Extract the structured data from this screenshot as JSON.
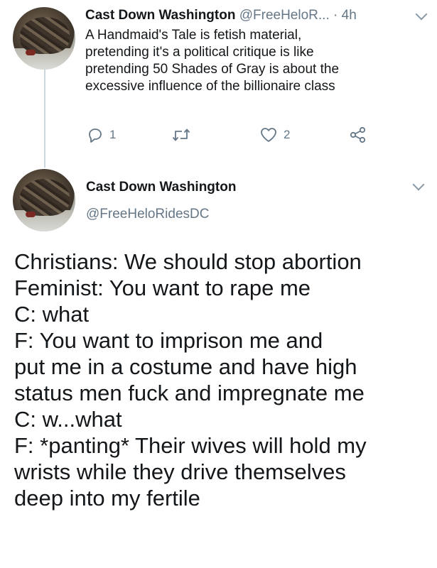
{
  "tweet1": {
    "author_name": "Cast Down Washington",
    "author_handle": "@FreeHeloR...",
    "separator": "·",
    "time": "4h",
    "text_lines": [
      "A Handmaid's Tale is fetish material,",
      "pretending it's a political critique is like",
      "pretending 50 Shades of Gray is about the",
      "excessive influence of the billionaire class"
    ],
    "reply_count": "1",
    "retweet_count": "",
    "like_count": "2"
  },
  "tweet2": {
    "author_name": "Cast Down Washington",
    "author_handle": "@FreeHeloRidesDC",
    "body_lines": [
      "Christians: We should stop abortion",
      "Feminist: You want to rape me",
      "C: what",
      "F: You want to imprison me and",
      "put me in a costume and have high",
      "status men fuck and impregnate me",
      "C: w...what",
      "F: *panting* Their wives will hold my",
      "wrists while they drive themselves",
      "deep into my fertile"
    ]
  },
  "icons": {
    "reply": "reply-icon",
    "retweet": "retweet-icon",
    "like": "heart-icon",
    "share": "share-icon",
    "menu": "chevron-down-icon"
  },
  "colors": {
    "text": "#14171a",
    "secondary": "#657786",
    "thread_line": "#ccd6dd"
  }
}
